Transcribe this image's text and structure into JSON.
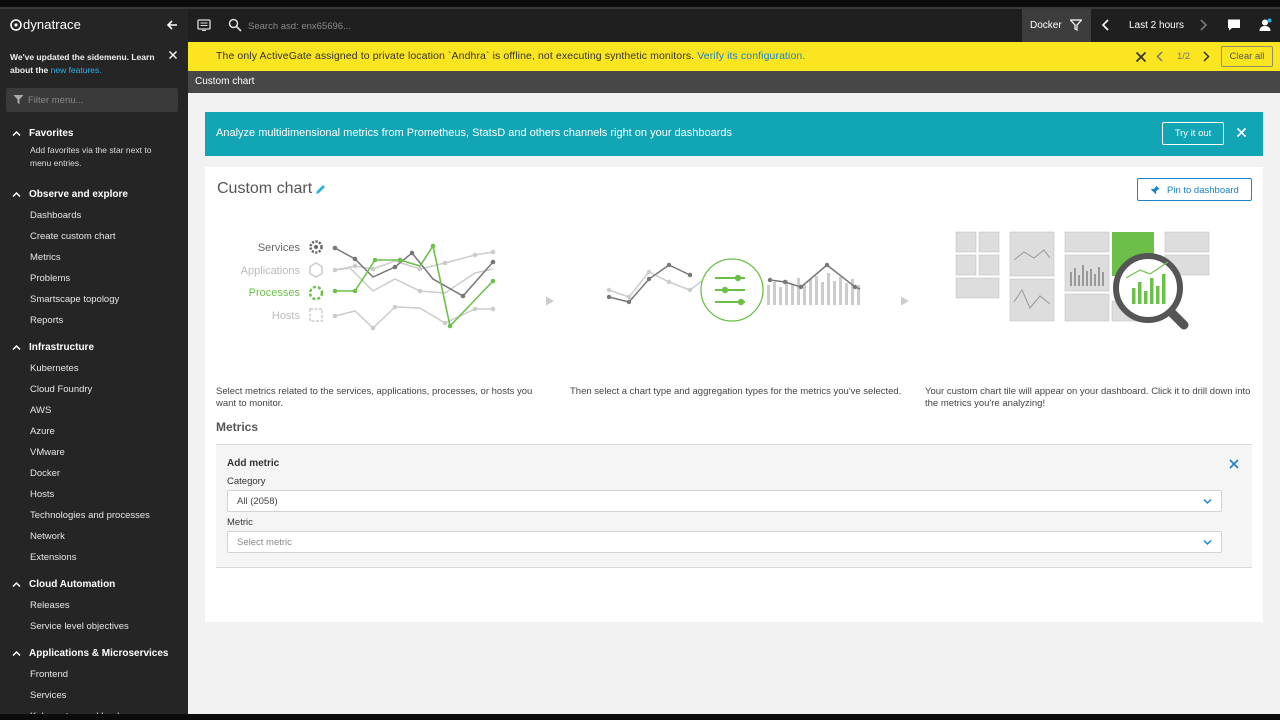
{
  "app": {
    "name": "dynatrace"
  },
  "sidebar": {
    "notice": {
      "text": "We've updated the sidemenu. Learn about the ",
      "link": "new features."
    },
    "filter_placeholder": "Filter menu...",
    "sections": [
      {
        "title": "Favorites",
        "note": "Add favorites via the star next to menu entries.",
        "items": []
      },
      {
        "title": "Observe and explore",
        "items": [
          "Dashboards",
          "Create custom chart",
          "Metrics",
          "Problems",
          "Smartscape topology",
          "Reports"
        ]
      },
      {
        "title": "Infrastructure",
        "items": [
          "Kubernetes",
          "Cloud Foundry",
          "AWS",
          "Azure",
          "VMware",
          "Docker",
          "Hosts",
          "Technologies and processes",
          "Network",
          "Extensions"
        ]
      },
      {
        "title": "Cloud Automation",
        "items": [
          "Releases",
          "Service level objectives"
        ]
      },
      {
        "title": "Applications & Microservices",
        "items": [
          "Frontend",
          "Services",
          "Kubernetes workloads"
        ]
      }
    ]
  },
  "topbar": {
    "search_placeholder": "Search asd: enx65696...",
    "filter_label": "Docker",
    "timeframe": "Last 2 hours"
  },
  "warning": {
    "text": "The only ActiveGate assigned to private location `Andhra` is offline, not executing synthetic monitors.",
    "link": "Verify its configuration.",
    "pager": "1/2",
    "clear_label": "Clear all"
  },
  "breadcrumb": "Custom chart",
  "banner": {
    "text": "Analyze multidimensional metrics from Prometheus, StatsD and others channels right on your dashboards",
    "button": "Try it out"
  },
  "panel": {
    "title": "Custom chart",
    "pin_label": "Pin to dashboard",
    "illustration_labels": [
      "Services",
      "Applications",
      "Processes",
      "Hosts"
    ],
    "steps": [
      "Select metrics related to the services, applications, processes, or hosts you want to monitor.",
      "Then select a chart type and aggregation types for the metrics you've selected.",
      "Your custom chart tile will appear on your dashboard. Click it to drill down into the metrics you're analyzing!"
    ],
    "metrics_heading": "Metrics",
    "add_metric": "Add metric",
    "category_label": "Category",
    "category_value": "All (2058)",
    "metric_label": "Metric",
    "metric_placeholder": "Select metric"
  },
  "colors": {
    "accent": "#1b82c9",
    "banner": "#11a5b6",
    "warning": "#fbe420",
    "green": "#6cc04a"
  }
}
